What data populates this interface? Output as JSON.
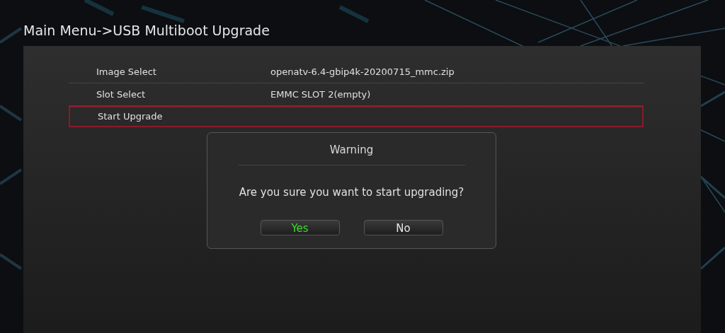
{
  "title": "Main Menu->USB Multiboot Upgrade",
  "rows": [
    {
      "label": "Image Select",
      "value": "openatv-6.4-gbip4k-20200715_mmc.zip",
      "selected": false
    },
    {
      "label": "Slot Select",
      "value": "EMMC SLOT 2(empty)",
      "selected": false
    },
    {
      "label": "Start Upgrade",
      "selected": true
    }
  ],
  "dialog": {
    "title": "Warning",
    "message": "Are you sure you want to start upgrading?",
    "buttons": [
      {
        "label": "Yes",
        "selected": true
      },
      {
        "label": "No",
        "selected": false
      }
    ]
  }
}
